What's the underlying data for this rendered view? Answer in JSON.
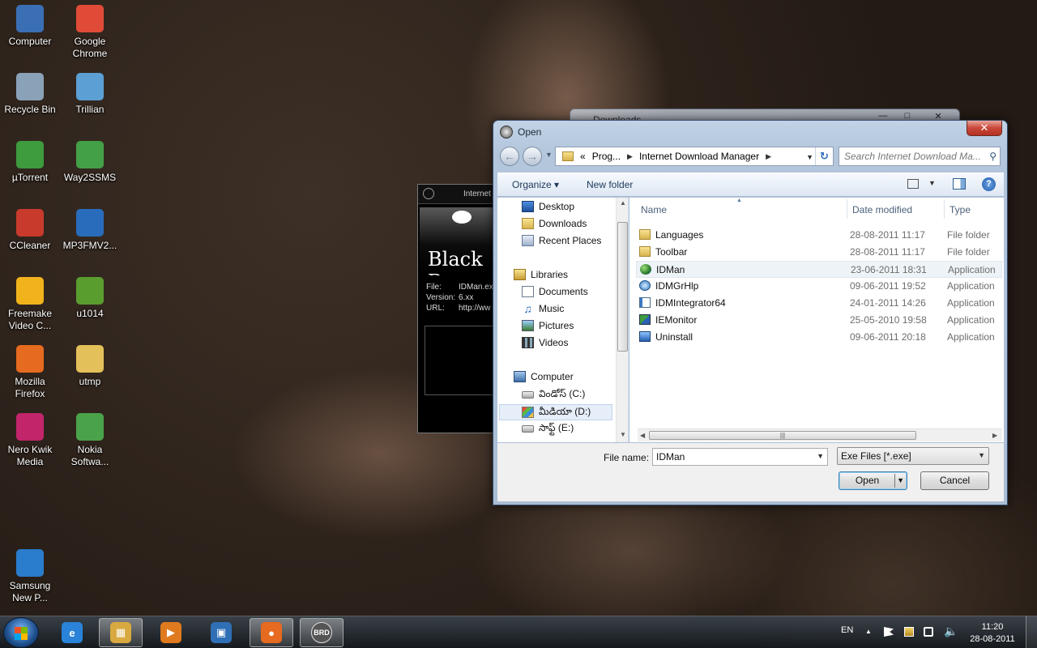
{
  "desktop_icons": [
    {
      "label": "Computer",
      "icon": "computer-icon",
      "color": "#3a6fb5"
    },
    {
      "label": "Google Chrome",
      "icon": "chrome-icon",
      "color": "#e04b37"
    },
    {
      "label": "Recycle Bin",
      "icon": "recycle-bin-icon",
      "color": "#8aa2b8"
    },
    {
      "label": "Trillian",
      "icon": "trillian-icon",
      "color": "#5b9fd4"
    },
    {
      "label": "µTorrent",
      "icon": "utorrent-icon",
      "color": "#3e9b3e"
    },
    {
      "label": "Way2SSMS",
      "icon": "way2sms-icon",
      "color": "#43a047"
    },
    {
      "label": "CCleaner",
      "icon": "ccleaner-icon",
      "color": "#c83a2b"
    },
    {
      "label": "MP3FMV2...",
      "icon": "mp3fmv-icon",
      "color": "#2a6cbc"
    },
    {
      "label": "Freemake Video C...",
      "icon": "freemake-icon",
      "color": "#f2b21c"
    },
    {
      "label": "u1014",
      "icon": "u1014-icon",
      "color": "#5a9d2f"
    },
    {
      "label": "Mozilla Firefox",
      "icon": "firefox-icon",
      "color": "#e66a1f"
    },
    {
      "label": "utmp",
      "icon": "folder-icon",
      "color": "#e4c05a"
    },
    {
      "label": "Nero Kwik Media",
      "icon": "nero-icon",
      "color": "#c2256a"
    },
    {
      "label": "Nokia Softwa...",
      "icon": "nokia-icon",
      "color": "#4aa34a"
    },
    {
      "label": "Samsung New P...",
      "icon": "samsung-icon",
      "color": "#2a7ccc"
    }
  ],
  "bg_windows": {
    "downloads_title": "Downloads",
    "idm_header": "Internet",
    "idm_brand": "Black R",
    "idm_file_key": "File:",
    "idm_file_val": "IDMan.ex",
    "idm_version_key": "Version:",
    "idm_version_val": "6.xx",
    "idm_url_key": "URL:",
    "idm_url_val": "http://ww"
  },
  "dialog": {
    "title": "Open",
    "close_label": "✕",
    "address": {
      "prefix": "«",
      "crumbs": [
        "Prog...",
        "Internet Download Manager"
      ]
    },
    "search_placeholder": "Search Internet Download Ma...",
    "toolbar": {
      "organize": "Organize",
      "new_folder": "New folder"
    },
    "nav": {
      "favorites": [
        "Desktop",
        "Downloads",
        "Recent Places"
      ],
      "libraries_label": "Libraries",
      "libraries": [
        "Documents",
        "Music",
        "Pictures",
        "Videos"
      ],
      "computer_label": "Computer",
      "drives": [
        "విండోస్ (C:)",
        "మీడియా (D:)",
        "సాఫ్ట్ (E:)"
      ]
    },
    "columns": {
      "name": "Name",
      "date": "Date modified",
      "type": "Type"
    },
    "files": [
      {
        "name": "Languages",
        "date": "28-08-2011 11:17",
        "type": "File folder",
        "icon": "folder"
      },
      {
        "name": "Toolbar",
        "date": "28-08-2011 11:17",
        "type": "File folder",
        "icon": "folder"
      },
      {
        "name": "IDMan",
        "date": "23-06-2011 18:31",
        "type": "Application",
        "icon": "globe"
      },
      {
        "name": "IDMGrHlp",
        "date": "09-06-2011 19:52",
        "type": "Application",
        "icon": "grhlp"
      },
      {
        "name": "IDMIntegrator64",
        "date": "24-01-2011 14:26",
        "type": "Application",
        "icon": "integ"
      },
      {
        "name": "IEMonitor",
        "date": "25-05-2010 19:58",
        "type": "Application",
        "icon": "iemon"
      },
      {
        "name": "Uninstall",
        "date": "09-06-2011 20:18",
        "type": "Application",
        "icon": "uninst"
      }
    ],
    "file_name_label": "File name:",
    "file_name_value": "IDMan",
    "file_type": "Exe Files [*.exe]",
    "open_label": "Open",
    "cancel_label": "Cancel"
  },
  "taskbar": {
    "lang": "EN",
    "time": "11:20",
    "date": "28-08-2011",
    "apps": [
      {
        "name": "internet-explorer",
        "glyph": "e",
        "color": "#2a83d8"
      },
      {
        "name": "windows-explorer",
        "glyph": "▦",
        "color": "#d8a940"
      },
      {
        "name": "media-player",
        "glyph": "▶",
        "color": "#e07a1e"
      },
      {
        "name": "tile-app",
        "glyph": "▣",
        "color": "#2f6fb6"
      },
      {
        "name": "firefox",
        "glyph": "●",
        "color": "#e66a1f"
      },
      {
        "name": "brd-app",
        "glyph": "BRD",
        "color": "#555555"
      }
    ]
  }
}
